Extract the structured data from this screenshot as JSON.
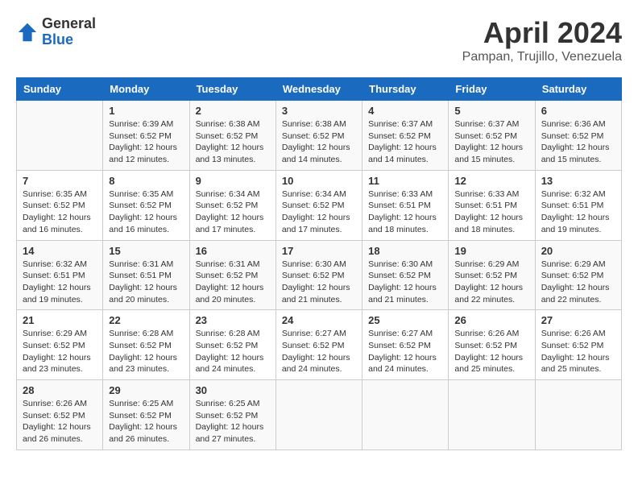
{
  "header": {
    "logo_general": "General",
    "logo_blue": "Blue",
    "month_year": "April 2024",
    "location": "Pampan, Trujillo, Venezuela"
  },
  "days_of_week": [
    "Sunday",
    "Monday",
    "Tuesday",
    "Wednesday",
    "Thursday",
    "Friday",
    "Saturday"
  ],
  "weeks": [
    [
      {
        "day": "",
        "info": ""
      },
      {
        "day": "1",
        "info": "Sunrise: 6:39 AM\nSunset: 6:52 PM\nDaylight: 12 hours\nand 12 minutes."
      },
      {
        "day": "2",
        "info": "Sunrise: 6:38 AM\nSunset: 6:52 PM\nDaylight: 12 hours\nand 13 minutes."
      },
      {
        "day": "3",
        "info": "Sunrise: 6:38 AM\nSunset: 6:52 PM\nDaylight: 12 hours\nand 14 minutes."
      },
      {
        "day": "4",
        "info": "Sunrise: 6:37 AM\nSunset: 6:52 PM\nDaylight: 12 hours\nand 14 minutes."
      },
      {
        "day": "5",
        "info": "Sunrise: 6:37 AM\nSunset: 6:52 PM\nDaylight: 12 hours\nand 15 minutes."
      },
      {
        "day": "6",
        "info": "Sunrise: 6:36 AM\nSunset: 6:52 PM\nDaylight: 12 hours\nand 15 minutes."
      }
    ],
    [
      {
        "day": "7",
        "info": "Sunrise: 6:35 AM\nSunset: 6:52 PM\nDaylight: 12 hours\nand 16 minutes."
      },
      {
        "day": "8",
        "info": "Sunrise: 6:35 AM\nSunset: 6:52 PM\nDaylight: 12 hours\nand 16 minutes."
      },
      {
        "day": "9",
        "info": "Sunrise: 6:34 AM\nSunset: 6:52 PM\nDaylight: 12 hours\nand 17 minutes."
      },
      {
        "day": "10",
        "info": "Sunrise: 6:34 AM\nSunset: 6:52 PM\nDaylight: 12 hours\nand 17 minutes."
      },
      {
        "day": "11",
        "info": "Sunrise: 6:33 AM\nSunset: 6:51 PM\nDaylight: 12 hours\nand 18 minutes."
      },
      {
        "day": "12",
        "info": "Sunrise: 6:33 AM\nSunset: 6:51 PM\nDaylight: 12 hours\nand 18 minutes."
      },
      {
        "day": "13",
        "info": "Sunrise: 6:32 AM\nSunset: 6:51 PM\nDaylight: 12 hours\nand 19 minutes."
      }
    ],
    [
      {
        "day": "14",
        "info": "Sunrise: 6:32 AM\nSunset: 6:51 PM\nDaylight: 12 hours\nand 19 minutes."
      },
      {
        "day": "15",
        "info": "Sunrise: 6:31 AM\nSunset: 6:51 PM\nDaylight: 12 hours\nand 20 minutes."
      },
      {
        "day": "16",
        "info": "Sunrise: 6:31 AM\nSunset: 6:52 PM\nDaylight: 12 hours\nand 20 minutes."
      },
      {
        "day": "17",
        "info": "Sunrise: 6:30 AM\nSunset: 6:52 PM\nDaylight: 12 hours\nand 21 minutes."
      },
      {
        "day": "18",
        "info": "Sunrise: 6:30 AM\nSunset: 6:52 PM\nDaylight: 12 hours\nand 21 minutes."
      },
      {
        "day": "19",
        "info": "Sunrise: 6:29 AM\nSunset: 6:52 PM\nDaylight: 12 hours\nand 22 minutes."
      },
      {
        "day": "20",
        "info": "Sunrise: 6:29 AM\nSunset: 6:52 PM\nDaylight: 12 hours\nand 22 minutes."
      }
    ],
    [
      {
        "day": "21",
        "info": "Sunrise: 6:29 AM\nSunset: 6:52 PM\nDaylight: 12 hours\nand 23 minutes."
      },
      {
        "day": "22",
        "info": "Sunrise: 6:28 AM\nSunset: 6:52 PM\nDaylight: 12 hours\nand 23 minutes."
      },
      {
        "day": "23",
        "info": "Sunrise: 6:28 AM\nSunset: 6:52 PM\nDaylight: 12 hours\nand 24 minutes."
      },
      {
        "day": "24",
        "info": "Sunrise: 6:27 AM\nSunset: 6:52 PM\nDaylight: 12 hours\nand 24 minutes."
      },
      {
        "day": "25",
        "info": "Sunrise: 6:27 AM\nSunset: 6:52 PM\nDaylight: 12 hours\nand 24 minutes."
      },
      {
        "day": "26",
        "info": "Sunrise: 6:26 AM\nSunset: 6:52 PM\nDaylight: 12 hours\nand 25 minutes."
      },
      {
        "day": "27",
        "info": "Sunrise: 6:26 AM\nSunset: 6:52 PM\nDaylight: 12 hours\nand 25 minutes."
      }
    ],
    [
      {
        "day": "28",
        "info": "Sunrise: 6:26 AM\nSunset: 6:52 PM\nDaylight: 12 hours\nand 26 minutes."
      },
      {
        "day": "29",
        "info": "Sunrise: 6:25 AM\nSunset: 6:52 PM\nDaylight: 12 hours\nand 26 minutes."
      },
      {
        "day": "30",
        "info": "Sunrise: 6:25 AM\nSunset: 6:52 PM\nDaylight: 12 hours\nand 27 minutes."
      },
      {
        "day": "",
        "info": ""
      },
      {
        "day": "",
        "info": ""
      },
      {
        "day": "",
        "info": ""
      },
      {
        "day": "",
        "info": ""
      }
    ]
  ]
}
